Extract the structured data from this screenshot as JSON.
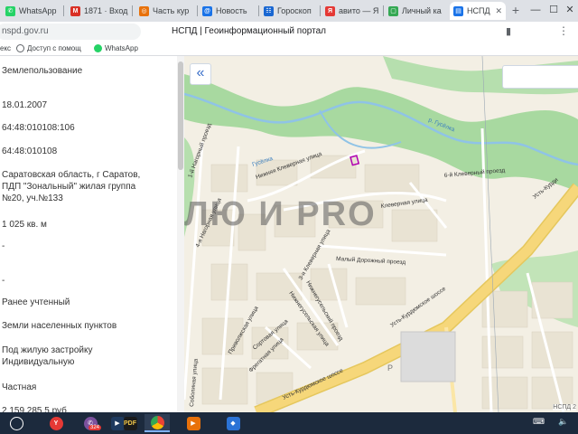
{
  "browser": {
    "tabs": [
      {
        "label": "WhatsApp",
        "icon": "whatsapp-icon",
        "color": "#25d366"
      },
      {
        "label": "1871 · Вход",
        "icon": "mail-icon",
        "color": "#d93025"
      },
      {
        "label": "Часть кур",
        "icon": "site-icon",
        "color": "#e8710a"
      },
      {
        "label": "Новость",
        "icon": "news-icon",
        "color": "#1a73e8"
      },
      {
        "label": "Гороскоп",
        "icon": "horoscope-icon",
        "color": "#1967d2"
      },
      {
        "label": "авито — Я",
        "icon": "yandex-icon",
        "color": "#e53935"
      },
      {
        "label": "Личный ка",
        "icon": "cabinet-icon",
        "color": "#34a853"
      },
      {
        "label": "НСПД",
        "icon": "nspd-icon",
        "color": "#1a73e8"
      }
    ],
    "new_tab_symbol": "+",
    "window": {
      "minimize": "—",
      "maximize": "☐",
      "close": "✕"
    },
    "url": "nspd.gov.ru",
    "page_title": "НСПД | Геоинформационный портал",
    "bookmarks": [
      {
        "label": "екс",
        "icon": "none"
      },
      {
        "label": "Доступ с помощ",
        "icon": "globe-icon"
      },
      {
        "label": "WhatsApp",
        "icon": "whatsapp-icon"
      }
    ]
  },
  "panel": {
    "fields": [
      {
        "lines": [
          "Землепользование"
        ]
      },
      {
        "lines": [
          "18.01.2007"
        ]
      },
      {
        "lines": [
          "64:48:010108:106"
        ]
      },
      {
        "lines": [
          "64:48:010108"
        ]
      },
      {
        "lines": [
          "Саратовская область, г Саратов,",
          "ПДП \"Зональный\" жилая группа",
          "№20, уч.№133"
        ]
      },
      {
        "lines": [
          "1 025 кв. м"
        ]
      },
      {
        "lines": [
          "-"
        ]
      },
      {
        "lines": [
          "-"
        ]
      },
      {
        "lines": [
          "Ранее учтенный"
        ]
      },
      {
        "lines": [
          "Земли населенных пунктов"
        ]
      },
      {
        "lines": [
          "Под жилую застройку",
          "Индивидуальную"
        ]
      },
      {
        "lines": [
          "Частная"
        ]
      },
      {
        "lines": [
          "2 159 285,5 руб."
        ]
      }
    ]
  },
  "map": {
    "collapse_symbol": "«",
    "watermark": "ЛЮ И PRO",
    "scale_label": "НСПД 2",
    "colors": {
      "greenery": "#a8d9a0",
      "water": "#8fc3e6",
      "road": "#fbe6a6",
      "highway": "#f6d77a",
      "background": "#f3efe4"
    },
    "street_labels": [
      "1-й Нагорный проезд",
      "4-я Нагорная улица",
      "Нижняя Клеверная улица",
      "Клеверная улица",
      "6-й Клеверный проезд",
      "3-я Клеверная улица",
      "Малый Дорожный проезд",
      "Усть-Курдюмское шоссе",
      "Усть-Курдюмское шоссе",
      "Нижнегусельский проезд",
      "Нижнегусельская улица",
      "Приволжская улица",
      "Фрегатная улица",
      "Соболиная улица",
      "Сортовая улица",
      "Усть-Курди",
      "Гусёлка",
      "р. Гусёлка",
      "Р"
    ]
  },
  "taskbar": {
    "apps": [
      {
        "name": "start",
        "icon": "start-icon",
        "color": "#ffffff"
      },
      {
        "name": "yandex",
        "icon": "yandex-browser-icon",
        "color": "#e53935"
      },
      {
        "name": "viber",
        "icon": "viber-icon",
        "color": "#7b519d",
        "badge": "324"
      },
      {
        "name": "media",
        "icon": "media-icon",
        "color": "#1e3a5f"
      },
      {
        "name": "pdf",
        "icon": "pdf-icon",
        "color": "#1b1b1b"
      },
      {
        "name": "chrome",
        "icon": "chrome-icon",
        "color": "#34a853"
      },
      {
        "name": "player",
        "icon": "player-icon",
        "color": "#e8710a"
      },
      {
        "name": "security",
        "icon": "shield-icon",
        "color": "#2b73d6"
      }
    ],
    "tray_keyboard": "⌨",
    "tray_speaker": "🔈"
  }
}
